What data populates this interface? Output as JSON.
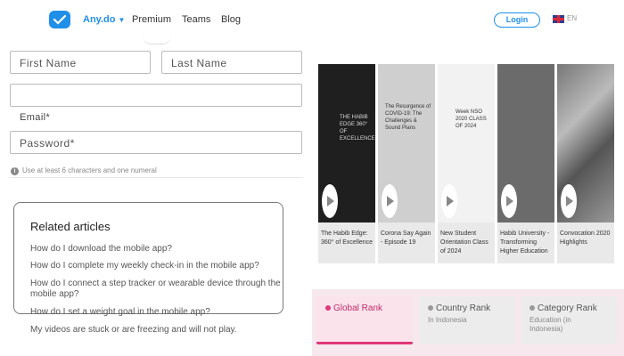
{
  "header": {
    "brand": "Any.do",
    "nav": [
      "Premium",
      "Teams",
      "Blog"
    ],
    "login": "Login",
    "lang": "EN"
  },
  "form": {
    "first_name": "First Name",
    "last_name": "Last Name",
    "email_value": "",
    "email_label": "Email*",
    "password_placeholder": "Password*",
    "hint": "Use at least 6 characters and one numeral"
  },
  "related": {
    "title": "Related articles",
    "articles": [
      "How do I download the mobile app?",
      "How do I complete my weekly check-in in the mobile app?",
      "How do I connect a step tracker or wearable device through the mobile app?",
      "How do I set a weight goal in the mobile app?",
      "My videos are stuck or are freezing and will not play."
    ]
  },
  "videos": [
    {
      "title": "The Habib Edge: 360° of Excellence",
      "thumb_text": "THE HABIB EDGE 360° OF EXCELLENCE"
    },
    {
      "title": "Corona Say Again - Episode 19",
      "thumb_text": "The Resurgence of COVID-19: The Challenges & Sound Plans"
    },
    {
      "title": "New Student Orientation Class of 2024",
      "thumb_text": "Week NSO 2020 CLASS OF 2024"
    },
    {
      "title": "Habib University - Transforming Higher Education",
      "thumb_text": ""
    },
    {
      "title": "Convocation 2020 Highlights",
      "thumb_text": ""
    }
  ],
  "ranks": [
    {
      "title": "Global Rank",
      "sub": "",
      "active": true
    },
    {
      "title": "Country Rank",
      "sub": "In Indonesia",
      "active": false
    },
    {
      "title": "Category Rank",
      "sub": "Education (in Indonesia)",
      "active": false
    }
  ],
  "colors": {
    "accent": "#1f8fe8",
    "rank_active": "#e0367a"
  }
}
